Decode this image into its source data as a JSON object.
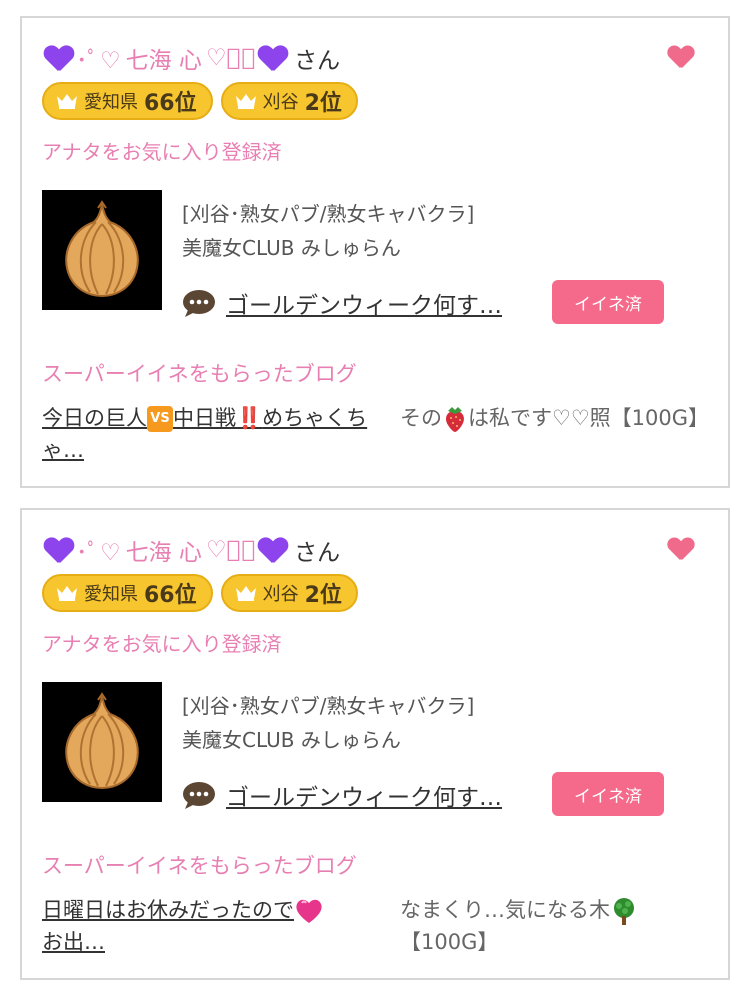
{
  "cards": [
    {
      "user": {
        "deco_left": "･ﾟ♡",
        "name": "七海 心",
        "deco_right": "♡ﾟ･",
        "suffix": "さん"
      },
      "badges": [
        {
          "region": "愛知県",
          "rank": "66位"
        },
        {
          "region": "刈谷",
          "rank": "2位"
        }
      ],
      "favorite_status": "アナタをお気に入り登録済",
      "shop": {
        "category": "[刈谷･熟女パブ/熟女キャバクラ]",
        "name": "美魔女CLUB みしゅらん"
      },
      "blog_link": "ゴールデンウィーク何す…",
      "iine_button": "イイネ済",
      "section_title": "スーパーイイネをもらったブログ",
      "blog_entry": {
        "part1": "今日の巨人",
        "vs": "VS",
        "part2": "中日戦",
        "bang": "‼️",
        "part3": "めちゃくちゃ…"
      },
      "comment": {
        "part1": "その",
        "part2": "は私です♡♡照【100G】"
      }
    },
    {
      "user": {
        "deco_left": "･ﾟ♡",
        "name": "七海 心",
        "deco_right": "♡ﾟ･",
        "suffix": "さん"
      },
      "badges": [
        {
          "region": "愛知県",
          "rank": "66位"
        },
        {
          "region": "刈谷",
          "rank": "2位"
        }
      ],
      "favorite_status": "アナタをお気に入り登録済",
      "shop": {
        "category": "[刈谷･熟女パブ/熟女キャバクラ]",
        "name": "美魔女CLUB みしゅらん"
      },
      "blog_link": "ゴールデンウィーク何す…",
      "iine_button": "イイネ済",
      "section_title": "スーパーイイネをもらったブログ",
      "blog_entry": {
        "part1": "日曜日はお休みだったので",
        "part2": "お出…"
      },
      "comment": {
        "part1": "なまくり…気になる木",
        "part2": "【100G】"
      }
    }
  ],
  "colors": {
    "pink_text": "#e87fb2",
    "purple_heart": "#8e44ec",
    "badge_gold": "#f7c52d",
    "iine_button": "#f5698a",
    "fav_heart": "#f06a8b"
  }
}
